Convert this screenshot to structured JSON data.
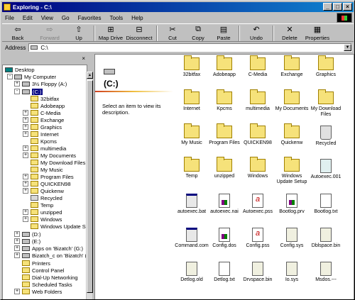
{
  "window": {
    "title": "Exploring - C:\\"
  },
  "menu": [
    "File",
    "Edit",
    "View",
    "Go",
    "Favorites",
    "Tools",
    "Help"
  ],
  "toolbar": {
    "back": "Back",
    "forward": "Forward",
    "up": "Up",
    "map_drive": "Map Drive",
    "disconnect": "Disconnect",
    "cut": "Cut",
    "copy": "Copy",
    "paste": "Paste",
    "undo": "Undo",
    "delete": "Delete",
    "properties": "Properties"
  },
  "address": {
    "label": "Address",
    "value": "C:\\"
  },
  "tree": {
    "items": [
      "Desktop",
      "My Computer",
      "3½ Floppy (A:)",
      "(C:)",
      "32bitfax",
      "Adobeapp",
      "C-Media",
      "Exchange",
      "Graphics",
      "Internet",
      "Kpcms",
      "multimedia",
      "My Documents",
      "My Download Files",
      "My Music",
      "Program Files",
      "QUICKEN98",
      "Quickenw",
      "Recycled",
      "Temp",
      "unzipped",
      "Windows",
      "Windows Update Setup",
      "(D:)",
      "(E:)",
      "Apps on 'Bizatch' (G:)",
      "Bizatch_c on 'Bizatch' (L:)",
      "Printers",
      "Control Panel",
      "Dial-Up Networking",
      "Scheduled Tasks",
      "Web Folders"
    ]
  },
  "side_panel": {
    "title": "(C:)",
    "description": "Select an item to view its description."
  },
  "files": [
    "32bitfax",
    "Adobeapp",
    "C-Media",
    "Exchange",
    "Graphics",
    "Internet",
    "Kpcms",
    "multimedia",
    "My Documents",
    "My Download Files",
    "My Music",
    "Program Files",
    "QUICKEN98",
    "Quickenw",
    "Recycled",
    "Temp",
    "unzipped",
    "Windows",
    "Windows Update Setup",
    "Autoexec.001",
    "autoexec.bat",
    "autoexec.nai",
    "Autoexec.pss",
    "Bootlog.prv",
    "Bootlog.txt",
    "Command.com",
    "Config.dos",
    "Config.pss",
    "Config.sys",
    "Dblspace.bin",
    "Detlog.old",
    "Detlog.txt",
    "Drvspace.bin",
    "Io.sys",
    "Msdos.---"
  ],
  "colors": {
    "titlebar": "#000080",
    "selection": "#000080",
    "folder": "#f6e27a"
  }
}
